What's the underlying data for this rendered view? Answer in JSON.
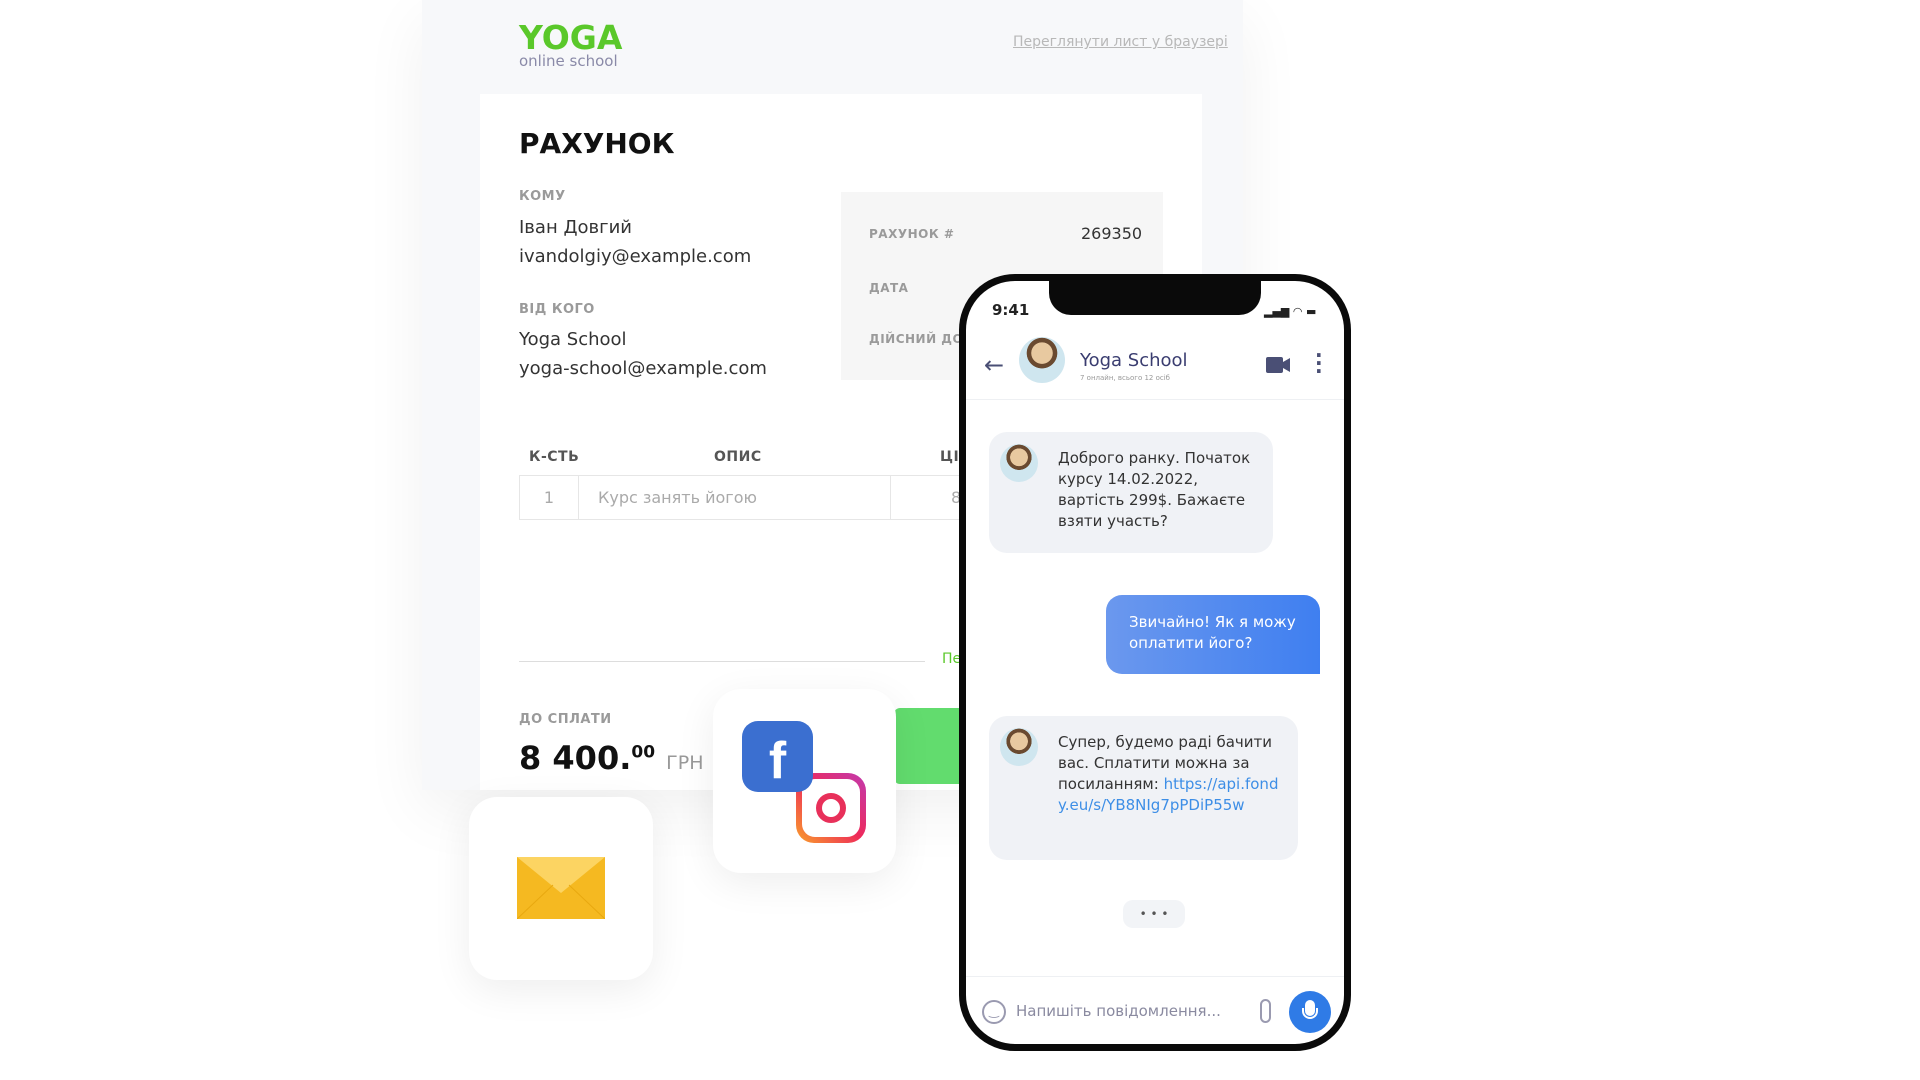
{
  "email": {
    "logo": {
      "title": "YOGA",
      "subtitle": "online school",
      "color": "#5ac82a"
    },
    "view_in_browser": "Переглянути лист у браузері",
    "title": "РАХУНОК",
    "to": {
      "label": "КОМУ",
      "name": "Іван Довгий",
      "email": "ivandolgiy@example.com"
    },
    "from": {
      "label": "ВІД КОГО",
      "name": "Yoga School",
      "email": "yoga-school@example.com"
    },
    "meta": {
      "invoice_label": "РАХУНОК #",
      "invoice_value": "269350",
      "date_label": "ДАТА",
      "valid_label": "ДІЙСНИЙ ДО"
    },
    "table": {
      "headers": [
        "К-СТЬ",
        "ОПИС",
        "ЦІ"
      ],
      "rows": [
        [
          "1",
          "Курс занять йогою",
          "8"
        ]
      ]
    },
    "green_link": "Пе",
    "total": {
      "label": "ДО СПЛАТИ",
      "amount": "8 400.",
      "cents": "00",
      "currency": "ГРН"
    }
  },
  "phone": {
    "time": "9:41",
    "chat": {
      "name": "Yoga School",
      "status": "7 онлайн, всього 12 осіб"
    },
    "messages": [
      {
        "from": "school",
        "text": "Доброго ранку. Початок курсу 14.02.2022, вартість 299$. Бажаєте взяти участь?"
      },
      {
        "from": "me",
        "text": "Звичайно! Як я можу оплатити його?"
      },
      {
        "from": "school",
        "text": "Супер, будемо раді бачити вас. Сплатити можна за посиланням:",
        "link": "https://api.fondy.eu/s/YB8NIg7pPDiP55w"
      }
    ],
    "typing": "• • •",
    "input_placeholder": "Напишіть повідомлення...",
    "accent": "#2f7be6"
  }
}
